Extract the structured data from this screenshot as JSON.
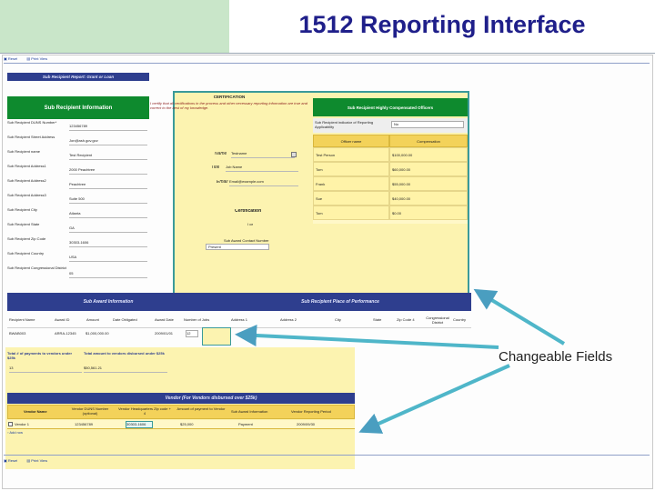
{
  "slide": {
    "title": "1512 Reporting Interface",
    "callout": "Changeable Fields"
  },
  "toolbar": {
    "top_items": [
      "Reset",
      "Print View"
    ],
    "bottom_items": [
      "Reset",
      "Print View"
    ]
  },
  "form": {
    "banner": "Sub Recipient Report: Grant or Loan",
    "info_header": "Sub Recipient Information",
    "info_rows": [
      {
        "label": "Sub Recipient DUNS Number*",
        "value": "123456789"
      },
      {
        "label": "Sub Recipient Street Address",
        "value": "Jon@ash.gov.gov"
      },
      {
        "label": "Sub Recipient name",
        "value": "Test Recipient"
      },
      {
        "label": "Sub Recipient Address1",
        "value": "2000 Peachtree"
      },
      {
        "label": "Sub Recipient Address2",
        "value": "Peachtree"
      },
      {
        "label": "Sub Recipient Address3",
        "value": "Suite 500"
      },
      {
        "label": "Sub Recipient City",
        "value": "Atlanta"
      },
      {
        "label": "Sub Recipient State",
        "value": "GA"
      },
      {
        "label": "Sub Recipient Zip Code",
        "value": "30303-1606"
      },
      {
        "label": "Sub Recipient Country",
        "value": "USA"
      },
      {
        "label": "Sub Recipient Congressional District",
        "value": "05"
      }
    ],
    "certification": {
      "title": "CERTIFICATION",
      "text": "I certify that all certifications in the process and other necessary reporting information are true and correct to the best of my knowledge.",
      "name_label": "Name",
      "name_value": "Testname",
      "title_label": "Title",
      "title_value": "Job Name",
      "email_label": "Email",
      "email_value": "Email@example.com",
      "cert_label": "Certification",
      "checkbox_label": "I certify",
      "award_label": "Sub Award Contact Number",
      "award_value": "Present"
    },
    "officers": {
      "header": "Sub Recipient Highly Compensated Officers",
      "question": "Sub Recipient indicator of Reporting Applicability",
      "answer": "No",
      "columns": [
        "Officer name",
        "Compensation"
      ],
      "rows": [
        {
          "name": "Test Person",
          "comp": "$100,000.00"
        },
        {
          "name": "Tom",
          "comp": "$60,000.00"
        },
        {
          "name": "Frank",
          "comp": "$55,000.00"
        },
        {
          "name": "Sue",
          "comp": "$40,000.00"
        },
        {
          "name": "Tom",
          "comp": "$0.00"
        }
      ]
    },
    "subaward": {
      "header_left": "Sub Award Information",
      "header_right": "Sub Recipient Place of Performance",
      "columns": [
        "Recipient Name",
        "Award ID",
        "Amount",
        "Date Obligated",
        "Award Date",
        "Number of Jobs",
        "Address 1",
        "Address 2",
        "City",
        "State",
        "Zip Code 4",
        "Congressional District",
        "Country"
      ],
      "row": [
        "BWAB003",
        "ARRA-12345",
        "$1,000,000.00",
        "",
        "2009/01/01",
        "12",
        "",
        "",
        "",
        "",
        "",
        "",
        ""
      ]
    },
    "totals": {
      "left_label": "Total # of payments to vendors under $25k",
      "right_label": "Total amount to vendors disbursed under $25k",
      "left_value": "13",
      "right_value": "$50,561.21"
    },
    "vendor": {
      "header": "Vendor (For Vendors disbursed over $25k)",
      "columns": [
        "Vendor Name",
        "Vendor DUNS Number (optional)",
        "Vendor Headquarters Zip code + 4",
        "Amount of payment to Vendor",
        "Sub Award Information",
        "Vendor Reporting Period"
      ],
      "row": [
        "Vendor 1",
        "123456789",
        "30303-1606",
        "$25,000",
        "Payment",
        "2009/09/30"
      ],
      "add_label": "Add row"
    }
  }
}
